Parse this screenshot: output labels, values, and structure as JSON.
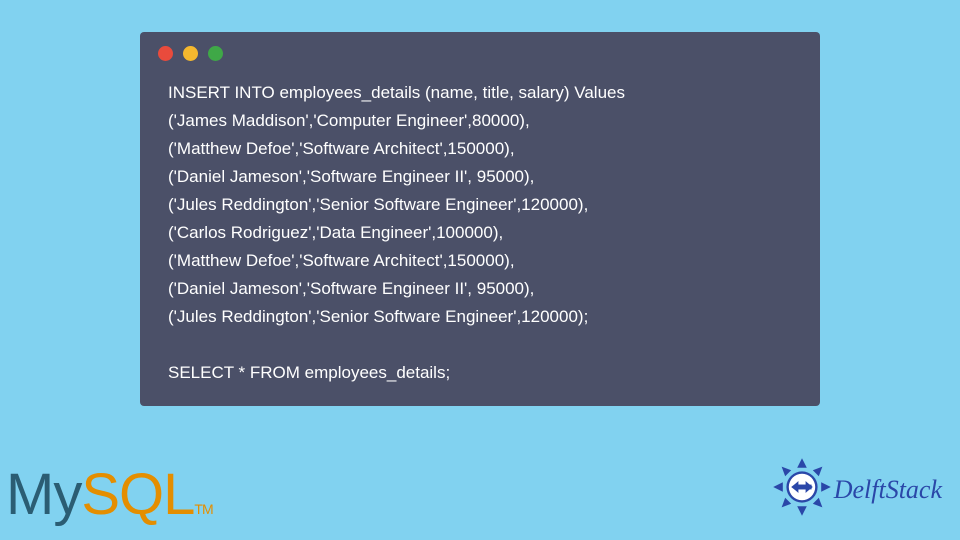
{
  "code": {
    "lines": [
      "INSERT INTO employees_details (name, title, salary) Values",
      "('James Maddison','Computer Engineer',80000),",
      "('Matthew Defoe','Software Architect',150000),",
      "('Daniel Jameson','Software Engineer II', 95000),",
      "('Jules Reddington','Senior Software Engineer',120000),",
      "('Carlos Rodriguez','Data Engineer',100000),",
      "('Matthew Defoe','Software Architect',150000),",
      "('Daniel Jameson','Software Engineer II', 95000),",
      "('Jules Reddington','Senior Software Engineer',120000);",
      "",
      "SELECT * FROM employees_details;"
    ]
  },
  "mysql_logo": {
    "my": "My",
    "sql": "SQL",
    "tm": "TM"
  },
  "delftstack": {
    "text": "DelftStack"
  },
  "colors": {
    "page_bg": "#81d2f0",
    "window_bg": "#4b5068",
    "dot_red": "#e94b3c",
    "dot_yellow": "#f5b82e",
    "dot_green": "#3fa847",
    "mysql_my": "#2b5d73",
    "mysql_sql": "#e48e00",
    "delftstack_blue": "#2a47a8"
  }
}
